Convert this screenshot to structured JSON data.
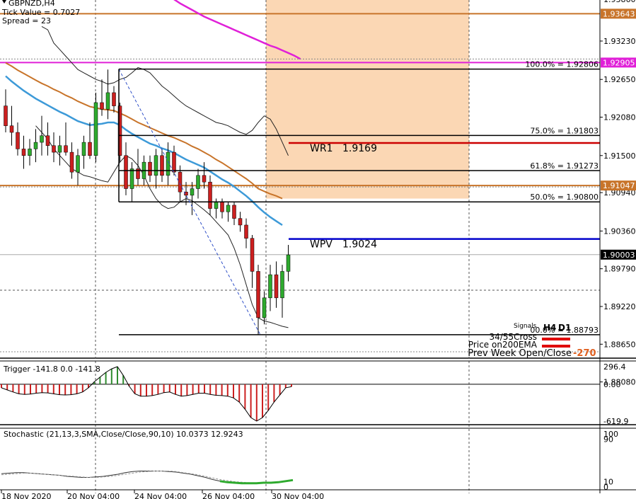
{
  "header": {
    "symbol": "GBPNZD,H4",
    "tick_value": "Tick Value = 0.7027",
    "spread": "Spread = 23"
  },
  "colors": {
    "bull": "#2eaa2e",
    "bear": "#cc1f1f",
    "ema_fast": "#3d9ad8",
    "ema_slow": "#c8742a",
    "ma_200": "#e020d8",
    "band": "#222222",
    "wr1": "#cc0000",
    "wpv": "#0000cc",
    "zone": "#fbd7b4",
    "hline_orange": "#c8742a"
  },
  "chart_data": [
    {
      "type": "candlestick",
      "title": "GBPNZD,H4",
      "ylim": [
        1.8845,
        1.9385
      ],
      "y_ticks": [
        "1.93860",
        "1.93230",
        "1.92650",
        "1.92080",
        "1.91500",
        "1.90940",
        "1.90360",
        "1.89790",
        "1.89220",
        "1.88650",
        "1.88080"
      ],
      "x_ticks": [
        "18 Nov 2020",
        "20 Nov 04:00",
        "24 Nov 04:00",
        "26 Nov 04:00",
        "30 Nov 04:00"
      ],
      "price_tags": [
        {
          "label": "1.93643",
          "value": 1.93643,
          "color": "#c8742a"
        },
        {
          "label": "1.92905",
          "value": 1.92905,
          "color": "#e020d8"
        },
        {
          "label": "1.91047",
          "value": 1.91047,
          "color": "#c8742a"
        },
        {
          "label": "1.90003",
          "value": 1.90003,
          "color": "#000000"
        }
      ],
      "fib_levels": [
        {
          "label": "100.0% = 1.92806",
          "value": 1.92806
        },
        {
          "label": "75.0% = 1.91803",
          "value": 1.91803
        },
        {
          "label": "61.8% = 1.91273",
          "value": 1.91273
        },
        {
          "label": "50.0% = 1.90800",
          "value": 1.908
        },
        {
          "label": "00.0% = 1.88793",
          "value": 1.88793
        }
      ],
      "pivots": [
        {
          "name": "WR1",
          "value_label": "1.9169",
          "value": 1.9169
        },
        {
          "name": "WPV",
          "value_label": "1.9024",
          "value": 1.9024
        }
      ],
      "candles": [
        {
          "o": 1.9225,
          "h": 1.925,
          "l": 1.9185,
          "c": 1.9195
        },
        {
          "o": 1.9195,
          "h": 1.9225,
          "l": 1.9165,
          "c": 1.9185
        },
        {
          "o": 1.9185,
          "h": 1.92,
          "l": 1.915,
          "c": 1.916
        },
        {
          "o": 1.916,
          "h": 1.918,
          "l": 1.913,
          "c": 1.915
        },
        {
          "o": 1.915,
          "h": 1.9175,
          "l": 1.9135,
          "c": 1.916
        },
        {
          "o": 1.916,
          "h": 1.919,
          "l": 1.914,
          "c": 1.917
        },
        {
          "o": 1.917,
          "h": 1.921,
          "l": 1.915,
          "c": 1.918
        },
        {
          "o": 1.918,
          "h": 1.92,
          "l": 1.915,
          "c": 1.9165
        },
        {
          "o": 1.9165,
          "h": 1.9185,
          "l": 1.914,
          "c": 1.9155
        },
        {
          "o": 1.9155,
          "h": 1.918,
          "l": 1.9135,
          "c": 1.9165
        },
        {
          "o": 1.9165,
          "h": 1.92,
          "l": 1.915,
          "c": 1.9155
        },
        {
          "o": 1.9155,
          "h": 1.917,
          "l": 1.9115,
          "c": 1.9125
        },
        {
          "o": 1.9125,
          "h": 1.916,
          "l": 1.9105,
          "c": 1.915
        },
        {
          "o": 1.915,
          "h": 1.918,
          "l": 1.913,
          "c": 1.917
        },
        {
          "o": 1.917,
          "h": 1.92,
          "l": 1.9145,
          "c": 1.915
        },
        {
          "o": 1.915,
          "h": 1.9245,
          "l": 1.914,
          "c": 1.923
        },
        {
          "o": 1.923,
          "h": 1.9265,
          "l": 1.921,
          "c": 1.922
        },
        {
          "o": 1.922,
          "h": 1.928,
          "l": 1.9205,
          "c": 1.9245
        },
        {
          "o": 1.9245,
          "h": 1.9255,
          "l": 1.9215,
          "c": 1.9225
        },
        {
          "o": 1.9225,
          "h": 1.923,
          "l": 1.914,
          "c": 1.915
        },
        {
          "o": 1.915,
          "h": 1.917,
          "l": 1.909,
          "c": 1.91
        },
        {
          "o": 1.91,
          "h": 1.914,
          "l": 1.908,
          "c": 1.913
        },
        {
          "o": 1.913,
          "h": 1.916,
          "l": 1.9105,
          "c": 1.9115
        },
        {
          "o": 1.9115,
          "h": 1.915,
          "l": 1.9105,
          "c": 1.914
        },
        {
          "o": 1.914,
          "h": 1.915,
          "l": 1.911,
          "c": 1.912
        },
        {
          "o": 1.912,
          "h": 1.916,
          "l": 1.91,
          "c": 1.915
        },
        {
          "o": 1.915,
          "h": 1.916,
          "l": 1.911,
          "c": 1.912
        },
        {
          "o": 1.912,
          "h": 1.917,
          "l": 1.9105,
          "c": 1.9155
        },
        {
          "o": 1.9155,
          "h": 1.9165,
          "l": 1.912,
          "c": 1.9125
        },
        {
          "o": 1.9125,
          "h": 1.9135,
          "l": 1.908,
          "c": 1.9095
        },
        {
          "o": 1.9095,
          "h": 1.911,
          "l": 1.9075,
          "c": 1.909
        },
        {
          "o": 1.909,
          "h": 1.911,
          "l": 1.906,
          "c": 1.91
        },
        {
          "o": 1.91,
          "h": 1.913,
          "l": 1.9085,
          "c": 1.912
        },
        {
          "o": 1.912,
          "h": 1.914,
          "l": 1.91,
          "c": 1.911
        },
        {
          "o": 1.911,
          "h": 1.912,
          "l": 1.906,
          "c": 1.907
        },
        {
          "o": 1.907,
          "h": 1.9085,
          "l": 1.9055,
          "c": 1.908
        },
        {
          "o": 1.908,
          "h": 1.9085,
          "l": 1.9055,
          "c": 1.9065
        },
        {
          "o": 1.9065,
          "h": 1.908,
          "l": 1.905,
          "c": 1.9075
        },
        {
          "o": 1.9075,
          "h": 1.908,
          "l": 1.9045,
          "c": 1.9055
        },
        {
          "o": 1.9055,
          "h": 1.9065,
          "l": 1.9035,
          "c": 1.9045
        },
        {
          "o": 1.9045,
          "h": 1.9055,
          "l": 1.901,
          "c": 1.9025
        },
        {
          "o": 1.9025,
          "h": 1.903,
          "l": 1.895,
          "c": 1.8975
        },
        {
          "o": 1.8975,
          "h": 1.8985,
          "l": 1.8879,
          "c": 1.8905
        },
        {
          "o": 1.8905,
          "h": 1.8945,
          "l": 1.8895,
          "c": 1.8935
        },
        {
          "o": 1.8935,
          "h": 1.8985,
          "l": 1.8915,
          "c": 1.897
        },
        {
          "o": 1.897,
          "h": 1.899,
          "l": 1.892,
          "c": 1.8935
        },
        {
          "o": 1.8935,
          "h": 1.8985,
          "l": 1.8905,
          "c": 1.8975
        },
        {
          "o": 1.8975,
          "h": 1.9015,
          "l": 1.896,
          "c": 1.9
        }
      ],
      "ema_fast": [
        1.927,
        1.9262,
        1.9255,
        1.9248,
        1.9242,
        1.9236,
        1.9231,
        1.9226,
        1.9221,
        1.9216,
        1.9212,
        1.9207,
        1.9202,
        1.9199,
        1.9196,
        1.9197,
        1.9198,
        1.92,
        1.92,
        1.9196,
        1.9189,
        1.9183,
        1.9178,
        1.9173,
        1.9168,
        1.9165,
        1.9161,
        1.9158,
        1.9154,
        1.9149,
        1.9144,
        1.914,
        1.9136,
        1.9132,
        1.9126,
        1.912,
        1.9114,
        1.9109,
        1.9103,
        1.9096,
        1.9089,
        1.9081,
        1.9072,
        1.9064,
        1.9057,
        1.9051,
        1.9045
      ],
      "ema_slow": [
        1.929,
        1.9285,
        1.9279,
        1.9274,
        1.9269,
        1.9264,
        1.9259,
        1.9255,
        1.925,
        1.9246,
        1.9241,
        1.9237,
        1.9232,
        1.9228,
        1.9224,
        1.9222,
        1.922,
        1.9219,
        1.9218,
        1.9214,
        1.921,
        1.9205,
        1.92,
        1.9196,
        1.9192,
        1.9188,
        1.9184,
        1.918,
        1.9177,
        1.9173,
        1.9169,
        1.9164,
        1.916,
        1.9155,
        1.915,
        1.9144,
        1.9139,
        1.9133,
        1.9127,
        1.9121,
        1.9115,
        1.9108,
        1.91,
        1.9096,
        1.9092,
        1.9089,
        1.9085
      ],
      "ma_200": [
        1.945,
        1.944,
        1.943,
        1.942,
        1.9412,
        1.9405,
        1.9398,
        1.9392,
        1.9386,
        1.938,
        1.9375,
        1.937,
        1.9365,
        1.936,
        1.9356,
        1.9352,
        1.9348,
        1.9344,
        1.934,
        1.9336,
        1.9332,
        1.9328,
        1.9324,
        1.932,
        1.9316,
        1.9313,
        1.9309,
        1.9305,
        1.9301,
        1.9296
      ],
      "bb_upper": [
        1.9345,
        1.934,
        1.932,
        1.931,
        1.93,
        1.929,
        1.928,
        1.9275,
        1.927,
        1.9265,
        1.9262,
        1.9258,
        1.926,
        1.9265,
        1.9268,
        1.9275,
        1.9283,
        1.928,
        1.9275,
        1.9265,
        1.9255,
        1.9248,
        1.924,
        1.9232,
        1.9225,
        1.922,
        1.9215,
        1.921,
        1.9205,
        1.92,
        1.9198,
        1.9195,
        1.919,
        1.9185,
        1.9182,
        1.9188,
        1.92,
        1.921,
        1.9205,
        1.919,
        1.917,
        1.915
      ],
      "bb_lower": [
        1.9195,
        1.9185,
        1.9175,
        1.916,
        1.915,
        1.914,
        1.913,
        1.9125,
        1.912,
        1.9118,
        1.9115,
        1.9112,
        1.911,
        1.9125,
        1.914,
        1.915,
        1.9145,
        1.9135,
        1.912,
        1.91,
        1.9085,
        1.9075,
        1.907,
        1.9072,
        1.908,
        1.9085,
        1.9082,
        1.9075,
        1.9068,
        1.906,
        1.905,
        1.904,
        1.903,
        1.901,
        1.8985,
        1.8955,
        1.8925,
        1.8905,
        1.89,
        1.8898,
        1.8895,
        1.8892,
        1.889
      ]
    },
    {
      "type": "bar",
      "title": "Trigger -141.8 0.0 -141.8",
      "ylim": [
        -619.9,
        296.4
      ],
      "y_ticks": [
        "296.4",
        "0.00",
        "-619.9"
      ],
      "values": [
        -60,
        -95,
        -130,
        -160,
        -170,
        -165,
        -150,
        -140,
        -145,
        -160,
        -175,
        -180,
        -175,
        -160,
        -130,
        -60,
        40,
        120,
        200,
        260,
        296,
        150,
        -30,
        -160,
        -200,
        -200,
        -190,
        -170,
        -140,
        -130,
        -170,
        -200,
        -190,
        -170,
        -150,
        -150,
        -170,
        -185,
        -190,
        -200,
        -230,
        -300,
        -420,
        -560,
        -619,
        -560,
        -440,
        -300,
        -180,
        -60,
        -40
      ]
    },
    {
      "type": "line",
      "title": "Stochastic (21,13,3,SMA,Close/Close,90,10) 10.0373 12.9243",
      "ylim": [
        0,
        100
      ],
      "y_ticks": [
        "100",
        "90",
        "10",
        "0"
      ],
      "series": [
        {
          "values": [
            25,
            26,
            27,
            27,
            26,
            25,
            24,
            23,
            22,
            20,
            19,
            18,
            18,
            19,
            20,
            22,
            24,
            27,
            29,
            30,
            30,
            30,
            30,
            29,
            28,
            26,
            24,
            21,
            18,
            14,
            11,
            9,
            8,
            7,
            7,
            7,
            8,
            8,
            9,
            11,
            13
          ]
        },
        {
          "values": [
            23,
            24,
            25,
            26,
            26,
            25,
            24,
            23,
            22,
            21,
            20,
            19,
            18,
            18,
            19,
            20,
            22,
            24,
            26,
            28,
            29,
            30,
            30,
            30,
            29,
            27,
            25,
            23,
            20,
            17,
            14,
            12,
            10,
            9,
            8,
            8,
            8,
            9,
            9,
            10,
            12
          ]
        }
      ],
      "highlight_range": [
        30,
        40
      ]
    }
  ],
  "signals": {
    "title": "Signals",
    "columns": [
      "H4",
      "D1"
    ],
    "rows": [
      {
        "label": "34/55Cross"
      },
      {
        "label": "Price on200EMA"
      },
      {
        "label": "Prev Week Open/Close",
        "value": "-270"
      }
    ]
  }
}
